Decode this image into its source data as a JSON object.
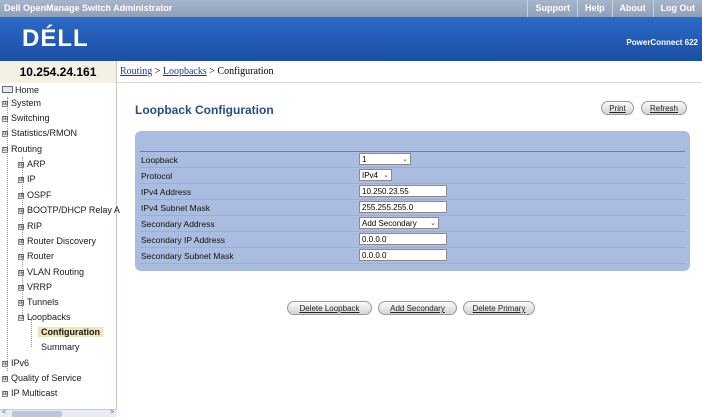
{
  "topbar": {
    "app_title": "Dell OpenManage Switch Administrator",
    "links": [
      "Support",
      "Help",
      "About",
      "Log Out"
    ]
  },
  "brand": {
    "logo": "DÉLL",
    "product": "PowerConnect 622"
  },
  "ip_address": "10.254.24.161",
  "breadcrumb": {
    "routing": "Routing",
    "loopbacks": "Loopbacks",
    "sep": " > ",
    "current": "Configuration"
  },
  "sidebar": {
    "home": "Home",
    "system": "System",
    "switching": "Switching",
    "statistics": "Statistics/RMON",
    "routing": "Routing",
    "arp": "ARP",
    "ip": "IP",
    "ospf": "OSPF",
    "bootp": "BOOTP/DHCP Relay A",
    "rip": "RIP",
    "router_discovery": "Router Discovery",
    "router": "Router",
    "vlan_routing": "VLAN Routing",
    "vrrp": "VRRP",
    "tunnels": "Tunnels",
    "loopbacks": "Loopbacks",
    "configuration": "Configuration",
    "summary": "Summary",
    "ipv6": "IPv6",
    "qos": "Quality of Service",
    "ip_multicast": "IP Multicast"
  },
  "page": {
    "title": "Loopback Configuration",
    "print": "Print",
    "refresh": "Refresh"
  },
  "form": {
    "loopback": {
      "label": "Loopback",
      "value": "1"
    },
    "protocol": {
      "label": "Protocol",
      "value": "IPv4"
    },
    "ipv4_address": {
      "label": "IPv4 Address",
      "value": "10.250.23.55"
    },
    "ipv4_mask": {
      "label": "IPv4 Subnet Mask",
      "value": "255.255.255.0"
    },
    "secondary_address": {
      "label": "Secondary Address",
      "value": "Add Secondary"
    },
    "secondary_ip": {
      "label": "Secondary IP Address",
      "value": "0.0.0.0"
    },
    "secondary_mask": {
      "label": "Secondary Subnet Mask",
      "value": "0.0.0.0"
    }
  },
  "actions": {
    "delete_loopback": "Delete Loopback",
    "add_secondary": "Add Secondary",
    "delete_primary": "Delete Primary"
  },
  "icons": {
    "tree_expand": "⊞",
    "tree_collapse": "⊟",
    "dropdown": "⌄",
    "scroll_left": "<",
    "scroll_right": ">"
  },
  "colors": {
    "brand_blue": "#1b4fa5",
    "panel_blue": "#aabde0",
    "title_blue": "#2a4a8a"
  }
}
